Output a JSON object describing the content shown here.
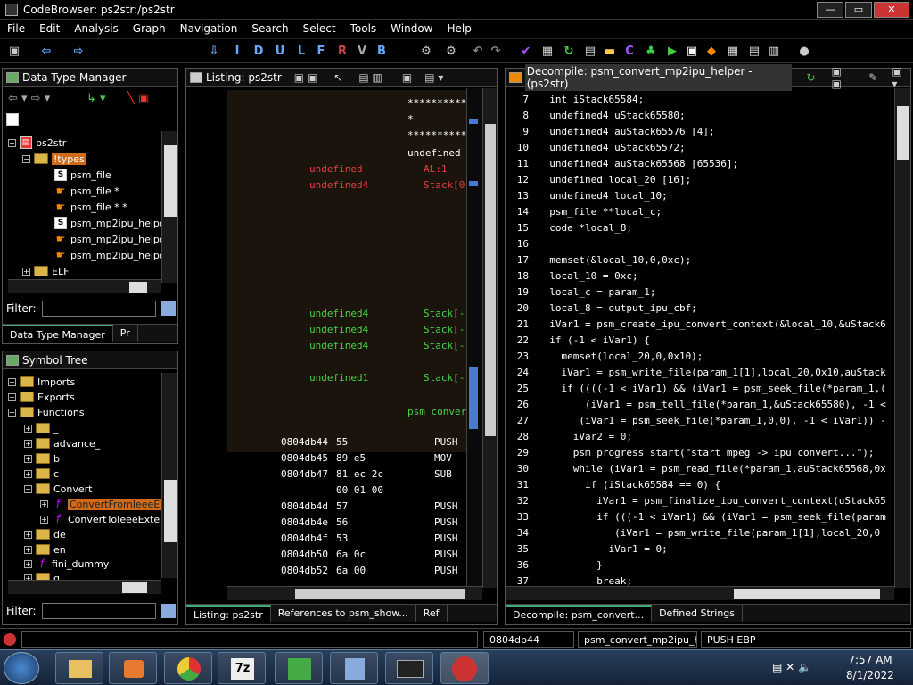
{
  "window": {
    "title": "CodeBrowser: ps2str:/ps2str",
    "min": "—",
    "max": "▭",
    "close": "✕"
  },
  "menu": [
    "File",
    "Edit",
    "Analysis",
    "Graph",
    "Navigation",
    "Search",
    "Select",
    "Tools",
    "Window",
    "Help"
  ],
  "toolbar_letters": [
    "I",
    "D",
    "U",
    "L",
    "F",
    "R",
    "V",
    "B"
  ],
  "dtm": {
    "title": "Data Type Manager",
    "root": "ps2str",
    "types_folder": "!types",
    "items": [
      "psm_file",
      "psm_file *",
      "psm_file * *",
      "psm_mp2ipu_helper",
      "psm_mp2ipu_helper",
      "psm_mp2ipu_helper"
    ],
    "elf": "ELF",
    "filter_label": "Filter:",
    "tab1": "Data Type Manager",
    "tab2": "Pr"
  },
  "symtree": {
    "title": "Symbol Tree",
    "imports": "Imports",
    "exports": "Exports",
    "functions": "Functions",
    "folders": [
      "_",
      "advance_",
      "b",
      "c"
    ],
    "convert": "Convert",
    "convert_children": [
      "ConvertFromIeeeE",
      "ConvertToIeeeExte"
    ],
    "folders2": [
      "de",
      "en"
    ],
    "fini": "fini_dummy",
    "g": "g",
    "filter_label": "Filter:"
  },
  "listing": {
    "title": "Listing:  ps2str",
    "stars": [
      "**********",
      "*",
      "**********"
    ],
    "header_type": "undefined",
    "vars1": [
      [
        "undefined",
        "AL:1"
      ],
      [
        "undefined4",
        "Stack[0"
      ]
    ],
    "vars2": [
      [
        "undefined4",
        "Stack[-"
      ],
      [
        "undefined4",
        "Stack[-"
      ],
      [
        "undefined4",
        "Stack[-"
      ],
      [
        "undefined1",
        "Stack[-"
      ]
    ],
    "func_label": "psm_conver",
    "instrs": [
      [
        "0804db44",
        "55",
        "PUSH"
      ],
      [
        "0804db45",
        "89 e5",
        "MOV"
      ],
      [
        "0804db47",
        "81 ec 2c",
        "SUB"
      ],
      [
        "",
        "00 01 00",
        ""
      ],
      [
        "0804db4d",
        "57",
        "PUSH"
      ],
      [
        "0804db4e",
        "56",
        "PUSH"
      ],
      [
        "0804db4f",
        "53",
        "PUSH"
      ],
      [
        "0804db50",
        "6a 0c",
        "PUSH"
      ],
      [
        "0804db52",
        "6a 00",
        "PUSH"
      ]
    ],
    "tabs": [
      "Listing:  ps2str",
      "References to psm_show...",
      "Ref"
    ]
  },
  "decompile": {
    "title": "Decompile: psm_convert_mp2ipu_helper -  (ps2str)",
    "lines": [
      [
        "7",
        "  int iStack65584;"
      ],
      [
        "8",
        "  undefined4 uStack65580;"
      ],
      [
        "9",
        "  undefined4 auStack65576 [4];"
      ],
      [
        "10",
        "  undefined4 uStack65572;"
      ],
      [
        "11",
        "  undefined4 auStack65568 [65536];"
      ],
      [
        "12",
        "  undefined local_20 [16];"
      ],
      [
        "13",
        "  undefined4 local_10;"
      ],
      [
        "14",
        "  psm_file **local_c;"
      ],
      [
        "15",
        "  code *local_8;"
      ],
      [
        "16",
        ""
      ],
      [
        "17",
        "  memset(&local_10,0,0xc);"
      ],
      [
        "18",
        "  local_10 = 0xc;"
      ],
      [
        "19",
        "  local_c = param_1;"
      ],
      [
        "20",
        "  local_8 = output_ipu_cbf;"
      ],
      [
        "21",
        "  iVar1 = psm_create_ipu_convert_context(&local_10,&uStack6"
      ],
      [
        "22",
        "  if (-1 < iVar1) {"
      ],
      [
        "23",
        "    memset(local_20,0,0x10);"
      ],
      [
        "24",
        "    iVar1 = psm_write_file(param_1[1],local_20,0x10,auStack"
      ],
      [
        "25",
        "    if ((((-1 < iVar1) && (iVar1 = psm_seek_file(*param_1,("
      ],
      [
        "26",
        "        (iVar1 = psm_tell_file(*param_1,&uStack65580), -1 <"
      ],
      [
        "27",
        "       (iVar1 = psm_seek_file(*param_1,0,0), -1 < iVar1)) -"
      ],
      [
        "28",
        "      iVar2 = 0;"
      ],
      [
        "29",
        "      psm_progress_start(\"start mpeg -> ipu convert...\");"
      ],
      [
        "30",
        "      while (iVar1 = psm_read_file(*param_1,auStack65568,0x"
      ],
      [
        "31",
        "        if (iStack65584 == 0) {"
      ],
      [
        "32",
        "          iVar1 = psm_finalize_ipu_convert_context(uStack65"
      ],
      [
        "33",
        "          if (((-1 < iVar1) && (iVar1 = psm_seek_file(param"
      ],
      [
        "34",
        "             (iVar1 = psm_write_file(param_1[1],local_20,0"
      ],
      [
        "35",
        "            iVar1 = 0;"
      ],
      [
        "36",
        "          }"
      ],
      [
        "37",
        "          break;"
      ]
    ],
    "tabs": [
      "Decompile: psm_convert...",
      "Defined Strings"
    ]
  },
  "status": {
    "addr": "0804db44",
    "func": "psm_convert_mp2ipu_h...",
    "instr": "PUSH EBP"
  },
  "clock": {
    "time": "7:57 AM",
    "date": "8/1/2022"
  },
  "taskbar_7z": "7z"
}
